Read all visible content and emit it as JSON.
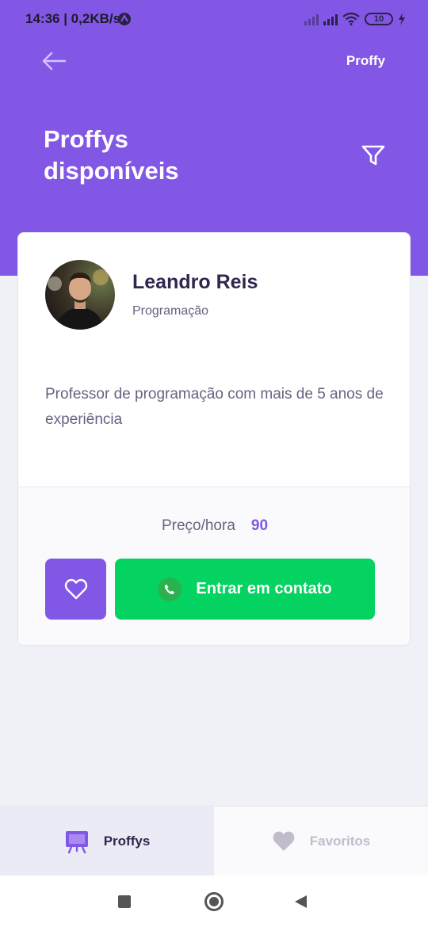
{
  "status_bar": {
    "time": "14:36 | 0,2KB/s",
    "battery": "10"
  },
  "header": {
    "brand": "Proffy",
    "title_line1": "Proffys",
    "title_line2": "disponíveis"
  },
  "teacher": {
    "name": "Leandro Reis",
    "subject": "Programação",
    "bio": "Professor de programação com mais de 5 anos de experiência",
    "price_label": "Preço/hora",
    "price_value": "90",
    "contact_label": "Entrar em contato"
  },
  "tabs": [
    {
      "label": "Proffys",
      "active": true
    },
    {
      "label": "Favoritos",
      "active": false
    }
  ],
  "colors": {
    "primary": "#8257e5",
    "secondary": "#04d361",
    "title_text": "#32264d",
    "muted_text": "#6a6180",
    "background": "#f0f0f7"
  }
}
